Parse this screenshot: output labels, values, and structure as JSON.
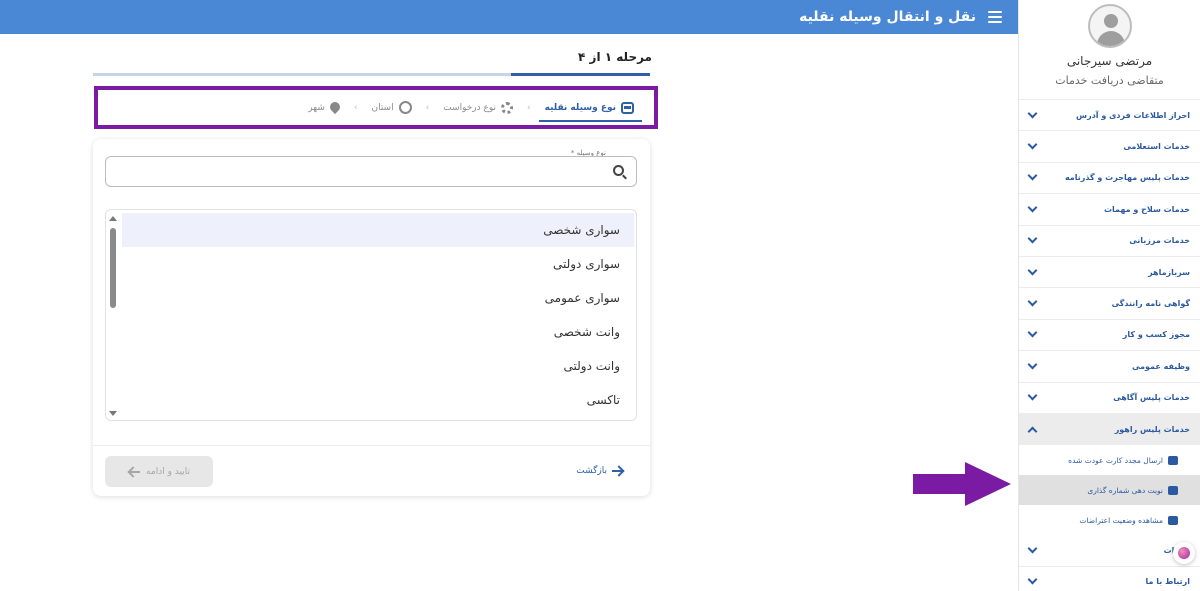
{
  "header": {
    "title": "نقل و انتقال وسیله نقلیه",
    "menu_icon": "hamburger-menu-icon",
    "background": "#4a88d6"
  },
  "sidebar": {
    "profile": {
      "name": "مرتضی سیرجانی",
      "role": "متقاضی دریافت خدمات",
      "avatar_icon": "user-avatar-icon"
    },
    "items": [
      {
        "label": "احراز اطلاعات فردی و آدرس",
        "expanded": false
      },
      {
        "label": "خدمات استعلامی",
        "expanded": false
      },
      {
        "label": "خدمات پلیس مهاجرت و گذرنامه",
        "expanded": false
      },
      {
        "label": "خدمات سلاح و مهمات",
        "expanded": false
      },
      {
        "label": "خدمات مرزبانی",
        "expanded": false
      },
      {
        "label": "سربازماهر",
        "expanded": false
      },
      {
        "label": "گواهی نامه رانندگی",
        "expanded": false
      },
      {
        "label": "مجوز کسب و کار",
        "expanded": false
      },
      {
        "label": "وظیفه عمومی",
        "expanded": false
      },
      {
        "label": "خدمات پلیس آگاهی",
        "expanded": false
      },
      {
        "label": "خدمات پلیس راهور",
        "expanded": true
      }
    ],
    "sub_items": [
      {
        "label": "ارسال مجدد کارت عودت شده",
        "active": false
      },
      {
        "label": "نوبت دهی شماره گذاری",
        "active": true
      },
      {
        "label": "مشاهده وضعیت اعتراضات",
        "active": false
      }
    ],
    "bottom_items": [
      {
        "label": "خدمات"
      },
      {
        "label": "ارتباط با ما"
      }
    ]
  },
  "stepper": {
    "progress_text": "مرحله ۱ از ۴",
    "progress_fraction": 0.25,
    "steps": [
      {
        "label": "نوع وسیله نقلیه",
        "icon": "bus-icon",
        "active": true
      },
      {
        "label": "نوع درخواست",
        "icon": "gear-icon",
        "active": false
      },
      {
        "label": "استان",
        "icon": "target-icon",
        "active": false
      },
      {
        "label": "شهر",
        "icon": "location-pin-icon",
        "active": false
      }
    ],
    "highlight_color": "#7b1aa3"
  },
  "form": {
    "field_label": "نوع وسیله *",
    "search_value": "",
    "options": [
      {
        "label": "سواری شخصی",
        "selected": true
      },
      {
        "label": "سواری دولتی",
        "selected": false
      },
      {
        "label": "سواری عمومی",
        "selected": false
      },
      {
        "label": "وانت شخصی",
        "selected": false
      },
      {
        "label": "وانت دولتی",
        "selected": false
      },
      {
        "label": "تاکسی",
        "selected": false
      }
    ],
    "confirm_label": "تایید و ادامه",
    "back_label": "بازگشت"
  },
  "annotation": {
    "color": "#7b1aa3",
    "icon": "pointer-arrow-icon"
  },
  "colors": {
    "primary": "#2f5fa6",
    "accent": "#7b1aa3"
  }
}
